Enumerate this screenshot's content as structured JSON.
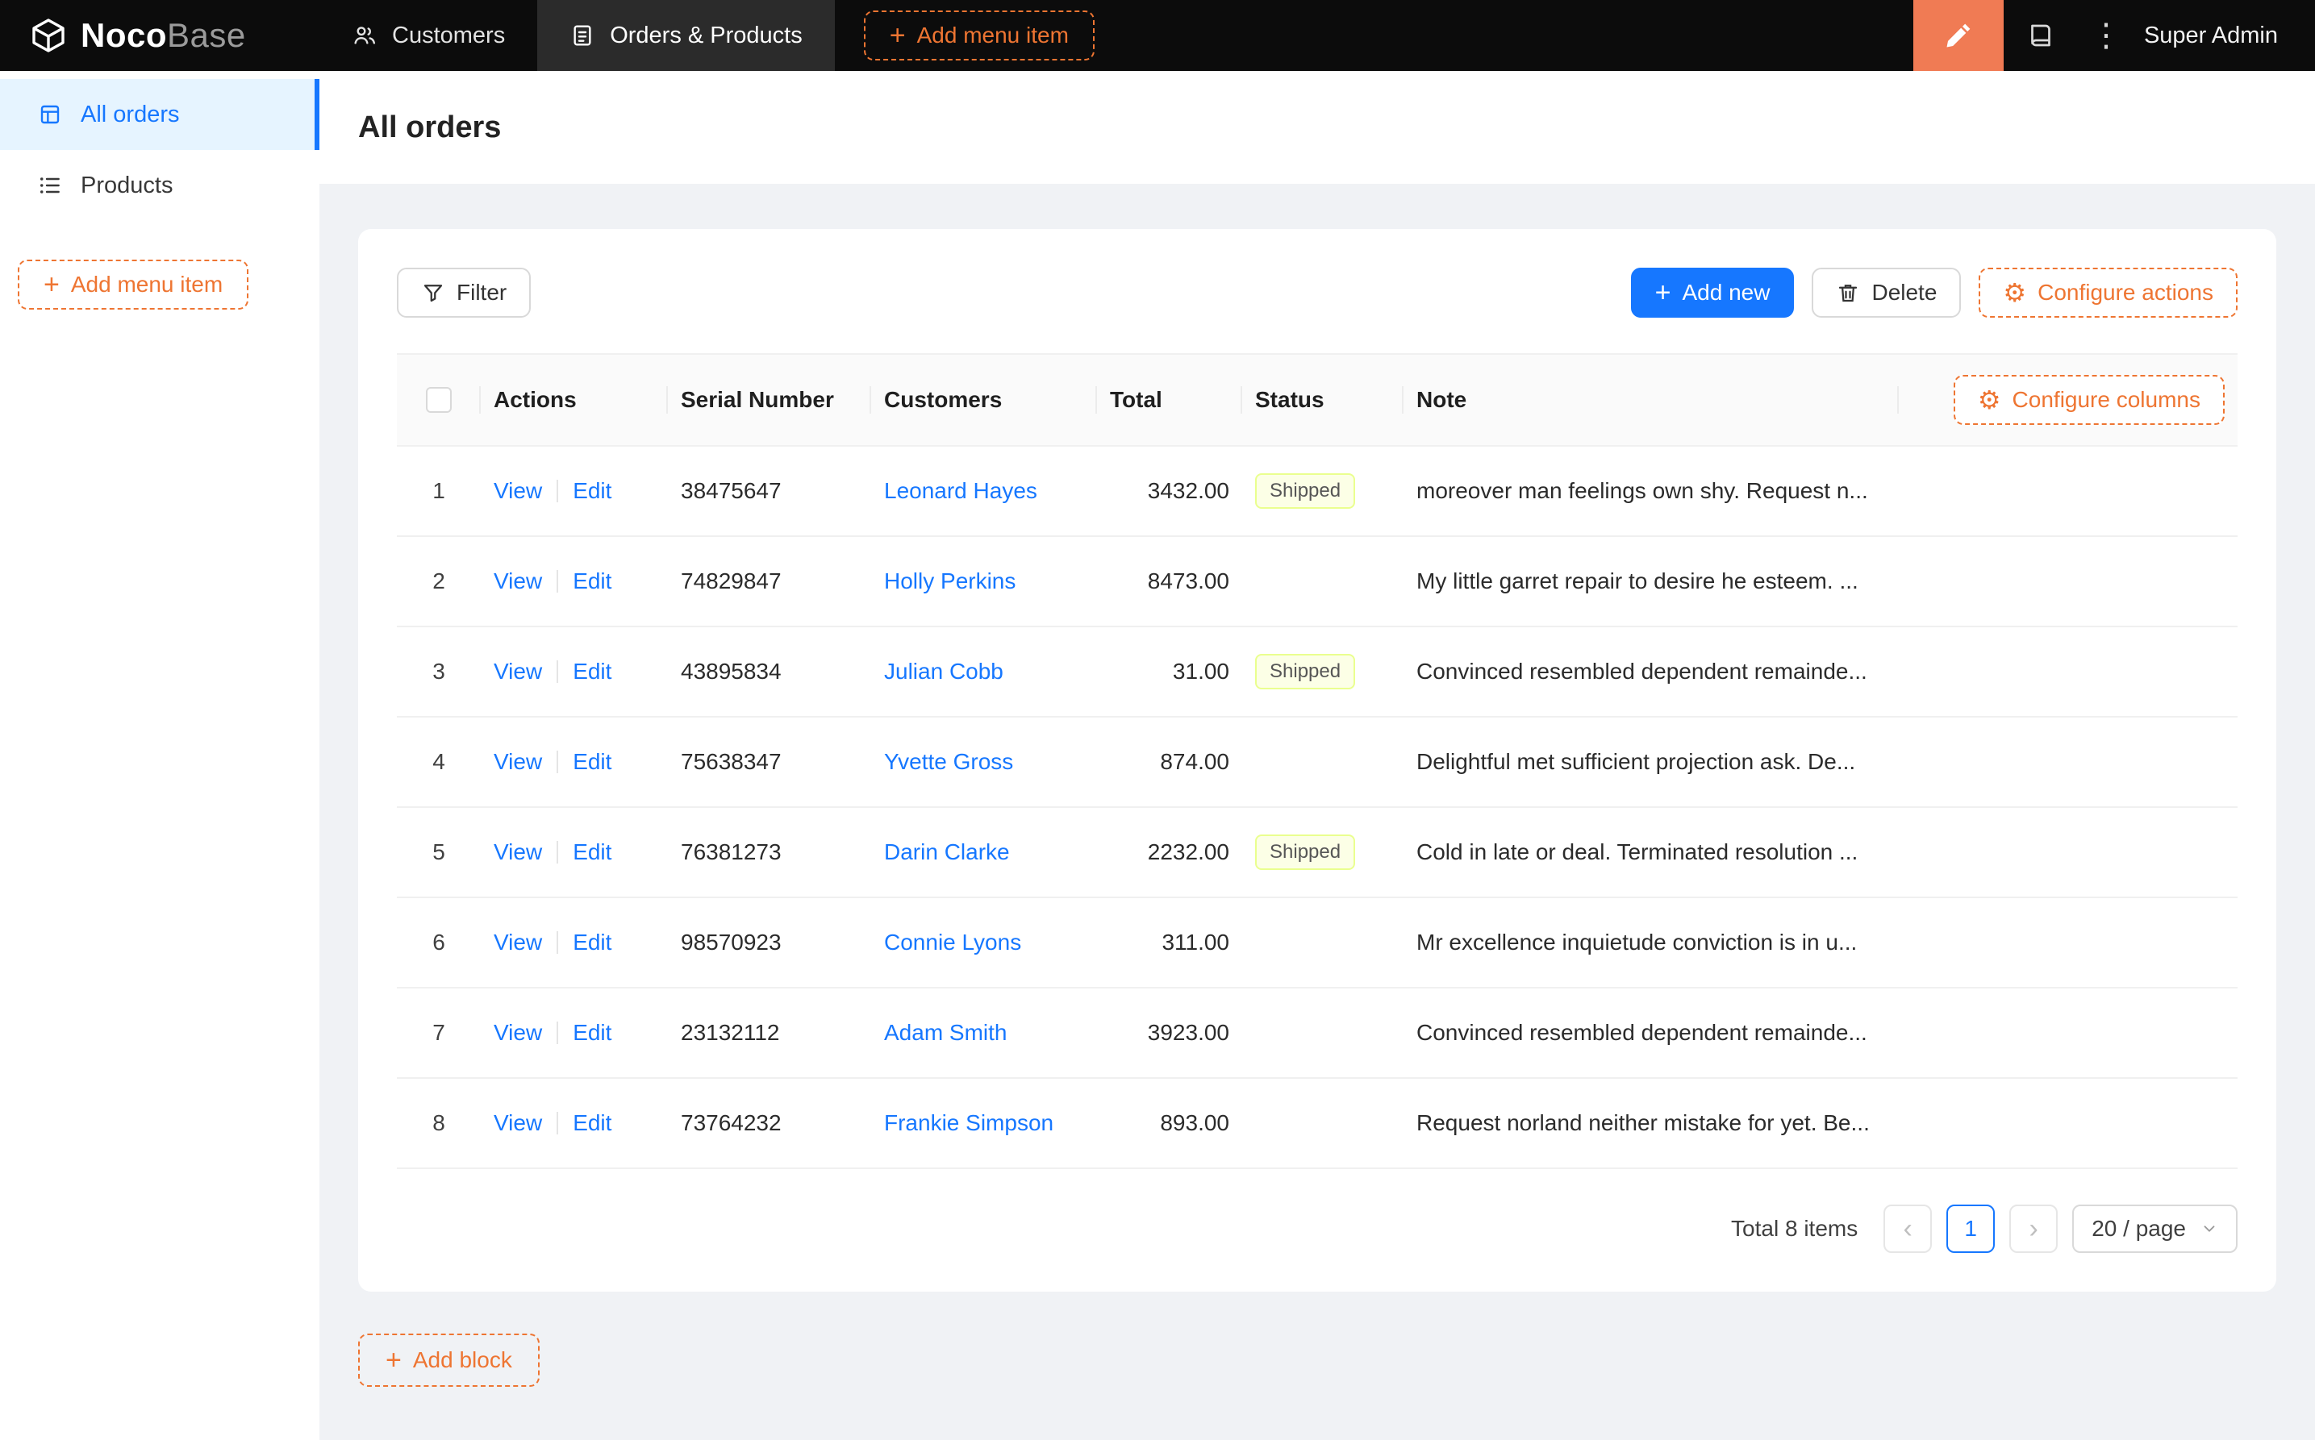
{
  "colors": {
    "accent_blue": "#1677ff",
    "accent_orange": "#ee7532",
    "designer_orange": "#f07b54",
    "navbar_bg": "#0c0c0c",
    "nav_active_bg": "#2b2b2b",
    "sidebar_active_bg": "#e6f4ff",
    "status_shipped_bg": "#fcffe6",
    "status_shipped_border": "#eaff8f"
  },
  "icons": {
    "plus": "+",
    "gear": "⚙",
    "kebab": "⋮",
    "prev": "‹",
    "next": "›",
    "logo": "nocobase-cube-icon",
    "customers": "team-icon",
    "orders_products": "file-icon",
    "designer": "pen-icon",
    "collections": "book-icon",
    "all_orders": "table-icon",
    "products": "list-icon",
    "filter": "funnel-icon",
    "delete": "trash-icon",
    "select_arrow": "chevron-down-icon"
  },
  "navbar": {
    "logo_bold": "Noco",
    "logo_light": "Base",
    "items": [
      {
        "label": "Customers",
        "active": false
      },
      {
        "label": "Orders & Products",
        "active": true
      }
    ],
    "add_menu_item": "Add menu item",
    "user": "Super Admin"
  },
  "sidebar": {
    "items": [
      {
        "label": "All orders",
        "active": true
      },
      {
        "label": "Products",
        "active": false
      }
    ],
    "add_menu_item": "Add menu item"
  },
  "page": {
    "title": "All orders"
  },
  "toolbar": {
    "filter": "Filter",
    "add_new": "Add new",
    "delete": "Delete",
    "configure_actions": "Configure actions"
  },
  "table": {
    "configure_columns": "Configure columns",
    "columns": [
      "Actions",
      "Serial Number",
      "Customers",
      "Total",
      "Status",
      "Note"
    ],
    "action_labels": {
      "view": "View",
      "edit": "Edit"
    },
    "rows": [
      {
        "index": "1",
        "serial": "38475647",
        "customer": "Leonard Hayes",
        "total": "3432.00",
        "status": "Shipped",
        "note": "moreover man feelings own shy. Request n..."
      },
      {
        "index": "2",
        "serial": "74829847",
        "customer": "Holly Perkins",
        "total": "8473.00",
        "status": "",
        "note": "My little garret repair to desire he esteem. ..."
      },
      {
        "index": "3",
        "serial": "43895834",
        "customer": "Julian Cobb",
        "total": "31.00",
        "status": "Shipped",
        "note": "Convinced resembled dependent remainde..."
      },
      {
        "index": "4",
        "serial": "75638347",
        "customer": "Yvette Gross",
        "total": "874.00",
        "status": "",
        "note": "Delightful met sufficient projection ask. De..."
      },
      {
        "index": "5",
        "serial": "76381273",
        "customer": "Darin Clarke",
        "total": "2232.00",
        "status": "Shipped",
        "note": "Cold in late or deal. Terminated resolution ..."
      },
      {
        "index": "6",
        "serial": "98570923",
        "customer": "Connie Lyons",
        "total": "311.00",
        "status": "",
        "note": "Mr excellence inquietude conviction is in u..."
      },
      {
        "index": "7",
        "serial": "23132112",
        "customer": "Adam Smith",
        "total": "3923.00",
        "status": "",
        "note": "Convinced resembled dependent remainde..."
      },
      {
        "index": "8",
        "serial": "73764232",
        "customer": "Frankie Simpson",
        "total": "893.00",
        "status": "",
        "note": "Request norland neither mistake for yet. Be..."
      }
    ]
  },
  "pagination": {
    "total_text": "Total 8 items",
    "current_page": "1",
    "page_size": "20 / page"
  },
  "footer": {
    "add_block": "Add block"
  }
}
